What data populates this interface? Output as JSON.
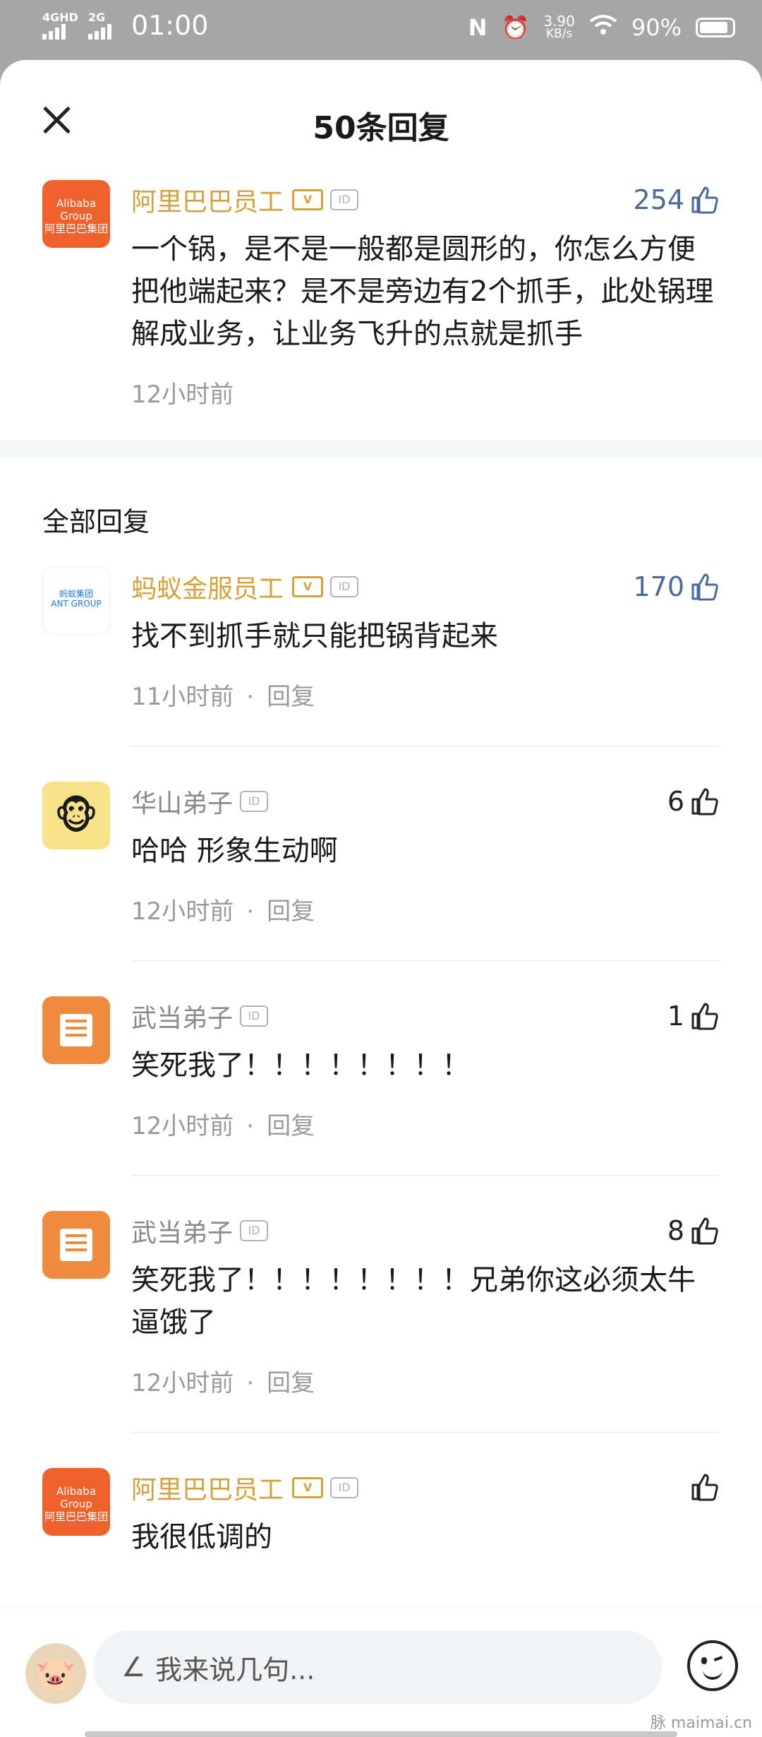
{
  "status": {
    "network_1": "4GHD",
    "network_2": "2G",
    "time": "01:00",
    "speed_value": "3.90",
    "speed_unit": "KB/s",
    "battery": "90%"
  },
  "header": {
    "title": "50条回复"
  },
  "main_comment": {
    "author": "阿里巴巴员工",
    "likes": "254",
    "text": "一个锅，是不是一般都是圆形的，你怎么方便把他端起来？是不是旁边有2个抓手，此处锅理解成业务，让业务飞升的点就是抓手",
    "time": "12小时前"
  },
  "section": {
    "title": "全部回复"
  },
  "replies": [
    {
      "author": "蚂蚁金服员工",
      "likes": "170",
      "text": "找不到抓手就只能把锅背起来",
      "time": "11小时前",
      "reply": "回复"
    },
    {
      "author": "华山弟子",
      "likes": "6",
      "text": "哈哈 形象生动啊",
      "time": "12小时前",
      "reply": "回复"
    },
    {
      "author": "武当弟子",
      "likes": "1",
      "text": "笑死我了！！！！！！！！",
      "time": "12小时前",
      "reply": "回复"
    },
    {
      "author": "武当弟子",
      "likes": "8",
      "text": "笑死我了！！！！！！！！兄弟你这必须太牛逼饿了",
      "time": "12小时前",
      "reply": "回复"
    },
    {
      "author": "阿里巴巴员工",
      "likes": "",
      "text": "我很低调的",
      "time": "",
      "reply": ""
    }
  ],
  "avatars": {
    "alibaba_line1": "Alibaba Group",
    "alibaba_line2": "阿里巴巴集团",
    "ant_line1": "蚂蚁集团",
    "ant_line2": "ANT GROUP"
  },
  "badges": {
    "verified": "V",
    "id": "ID"
  },
  "composer": {
    "placeholder": "我来说几句..."
  },
  "watermark": "脉 maimai.cn",
  "colors": {
    "gold": "#d7a13a",
    "like_blue": "#4a6a9a",
    "alibaba_orange": "#f0612c"
  }
}
